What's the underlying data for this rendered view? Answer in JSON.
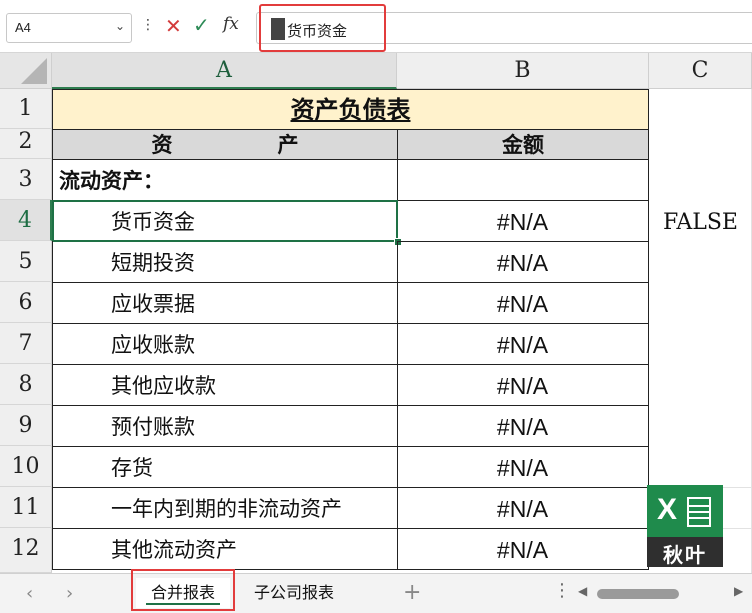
{
  "formula_bar": {
    "name_box": "A4",
    "name_box_chevron": "⌄",
    "separator": "⋮",
    "cancel_symbol": "✕",
    "enter_symbol": "✓",
    "fx_label": "fx",
    "content": "货币资金"
  },
  "columns": [
    "A",
    "B",
    "C"
  ],
  "rows": [
    "1",
    "2",
    "3",
    "4",
    "5",
    "6",
    "7",
    "8",
    "9",
    "10",
    "11",
    "12"
  ],
  "sheet": {
    "title": "资产负债表",
    "header_asset": "资　　　　　产",
    "header_amount": "金额",
    "section_label": "流动资产：",
    "items": [
      {
        "name": "货币资金",
        "value": "#N/A"
      },
      {
        "name": "短期投资",
        "value": "#N/A"
      },
      {
        "name": "应收票据",
        "value": "#N/A"
      },
      {
        "name": "应收账款",
        "value": "#N/A"
      },
      {
        "name": "其他应收款",
        "value": "#N/A"
      },
      {
        "name": "预付账款",
        "value": "#N/A"
      },
      {
        "name": "存货",
        "value": "#N/A"
      },
      {
        "name": "一年内到期的非流动资产",
        "value": "#N/A"
      },
      {
        "name": "其他流动资产",
        "value": "#N/A"
      }
    ],
    "c4_value": "FALSE"
  },
  "tabs": {
    "prev": "‹",
    "next": "›",
    "items": [
      {
        "label": "合并报表"
      },
      {
        "label": "子公司报表"
      }
    ],
    "add": "+",
    "more": "⋮"
  },
  "logo": {
    "letter": "X",
    "text": "秋叶"
  },
  "colors": {
    "accent": "#1e7145",
    "highlight": "#e23c3c",
    "title_fill": "#fff2cc",
    "header_fill": "#d9d9d9"
  }
}
